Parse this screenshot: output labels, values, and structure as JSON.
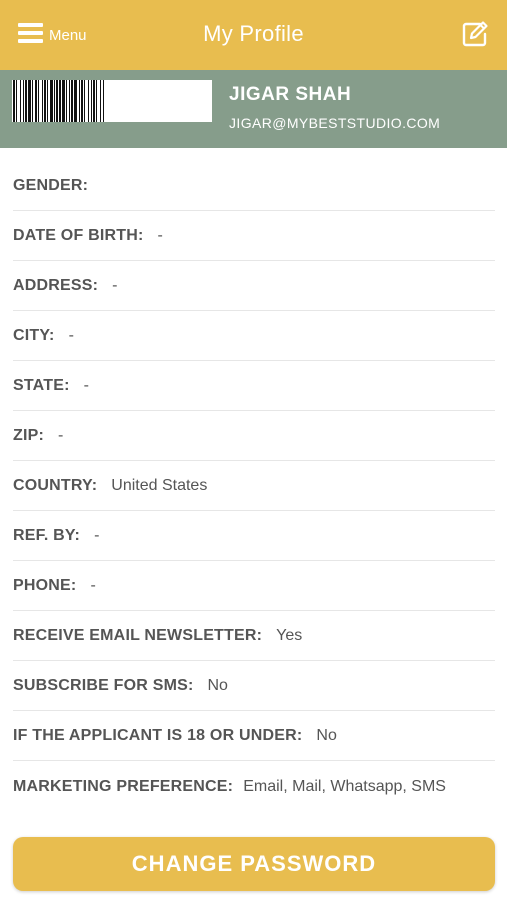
{
  "header": {
    "menu_label": "Menu",
    "title": "My Profile",
    "accent_color": "#e8bd4f"
  },
  "profile": {
    "name": "JIGAR SHAH",
    "email": "JIGAR@MYBESTSTUDIO.COM",
    "band_color": "#869d8b"
  },
  "fields": [
    {
      "label": "GENDER:",
      "value": ""
    },
    {
      "label": "DATE OF BIRTH:",
      "value": "-"
    },
    {
      "label": "ADDRESS:",
      "value": "-"
    },
    {
      "label": "CITY:",
      "value": "-"
    },
    {
      "label": "STATE:",
      "value": "-"
    },
    {
      "label": "ZIP:",
      "value": "-"
    },
    {
      "label": "COUNTRY:",
      "value": "United States"
    },
    {
      "label": "REF. BY:",
      "value": "-"
    },
    {
      "label": "PHONE:",
      "value": "-"
    },
    {
      "label": "RECEIVE EMAIL NEWSLETTER:",
      "value": "Yes"
    },
    {
      "label": "SUBSCRIBE FOR SMS:",
      "value": "No"
    },
    {
      "label": "IF THE APPLICANT IS 18 OR UNDER:",
      "value": "No"
    },
    {
      "label": "MARKETING PREFERENCE:",
      "value": "Email, Mail, Whatsapp, SMS"
    }
  ],
  "actions": {
    "change_password_label": "CHANGE PASSWORD"
  },
  "icons": {
    "menu": "hamburger-icon",
    "edit": "edit-icon",
    "barcode": "barcode-image"
  }
}
